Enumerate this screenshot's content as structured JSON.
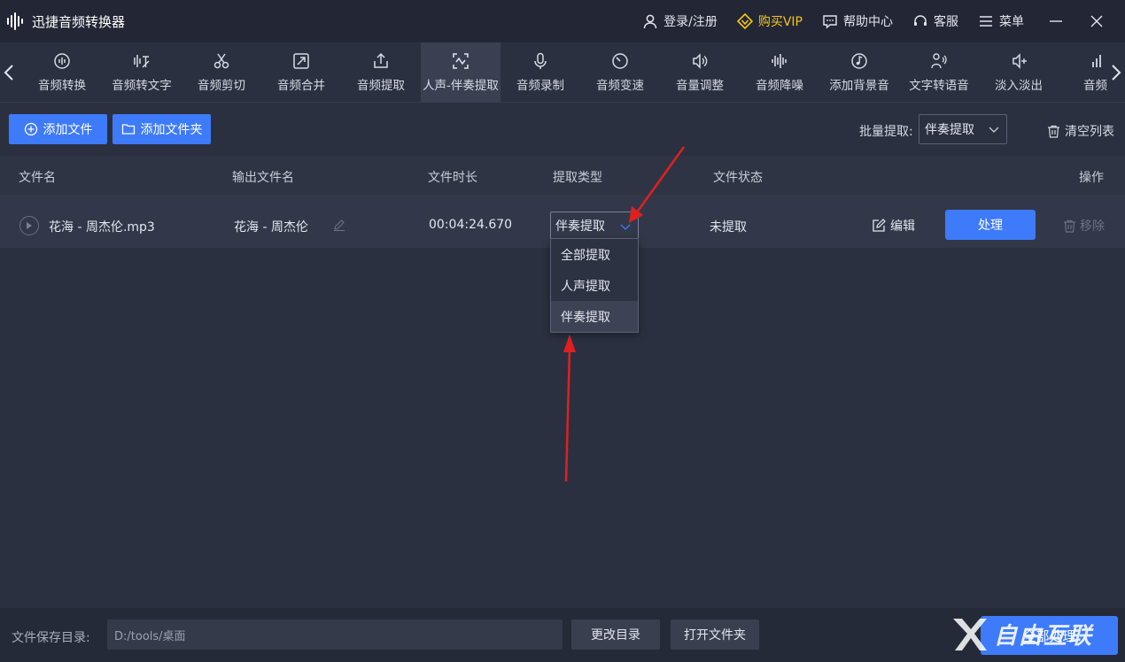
{
  "app": {
    "title": "迅捷音频转换器"
  },
  "titlebar": {
    "login": "登录/注册",
    "vip": "购买VIP",
    "help": "帮助中心",
    "service": "客服",
    "menu": "菜单"
  },
  "tools": [
    {
      "label": "音频转换",
      "icon": "audio-convert-icon"
    },
    {
      "label": "音频转文字",
      "icon": "audio-to-text-icon"
    },
    {
      "label": "音频剪切",
      "icon": "scissors-icon"
    },
    {
      "label": "音频合并",
      "icon": "merge-icon"
    },
    {
      "label": "音频提取",
      "icon": "upload-icon"
    },
    {
      "label": "人声-伴奏提取",
      "icon": "voice-separate-icon",
      "active": true
    },
    {
      "label": "音频录制",
      "icon": "microphone-icon"
    },
    {
      "label": "音频变速",
      "icon": "speed-icon"
    },
    {
      "label": "音量调整",
      "icon": "volume-icon"
    },
    {
      "label": "音频降噪",
      "icon": "waveform-icon"
    },
    {
      "label": "添加背景音",
      "icon": "music-note-icon"
    },
    {
      "label": "文字转语音",
      "icon": "text-to-speech-icon"
    },
    {
      "label": "淡入淡出",
      "icon": "fade-icon"
    },
    {
      "label": "音频s",
      "icon": "bars-icon"
    }
  ],
  "actions": {
    "add_file": "添加文件",
    "add_folder": "添加文件夹",
    "batch_label": "批量提取:",
    "batch_value": "伴奏提取",
    "clear_list": "清空列表"
  },
  "table": {
    "headers": {
      "filename": "文件名",
      "output": "输出文件名",
      "duration": "文件时长",
      "type": "提取类型",
      "status": "文件状态",
      "ops": "操作"
    },
    "row": {
      "filename": "花海 - 周杰伦.mp3",
      "output": "花海 - 周杰伦",
      "duration": "00:04:24.670",
      "type": "伴奏提取",
      "status": "未提取",
      "edit": "编辑",
      "process": "处理",
      "remove": "移除"
    }
  },
  "dropdown": {
    "options": [
      "全部提取",
      "人声提取",
      "伴奏提取"
    ],
    "selected_index": 2
  },
  "bottom": {
    "save_label": "文件保存目录:",
    "save_path": "D:/tools/桌面",
    "change_dir": "更改目录",
    "open_folder": "打开文件夹",
    "process_all": "全部处理"
  },
  "watermark": {
    "text": "自由互联"
  },
  "colors": {
    "accent": "#3e7bfa",
    "background": "#2b3040",
    "titlebar": "#232735",
    "vip": "#f5c518",
    "annotation_arrow": "#e02020"
  }
}
